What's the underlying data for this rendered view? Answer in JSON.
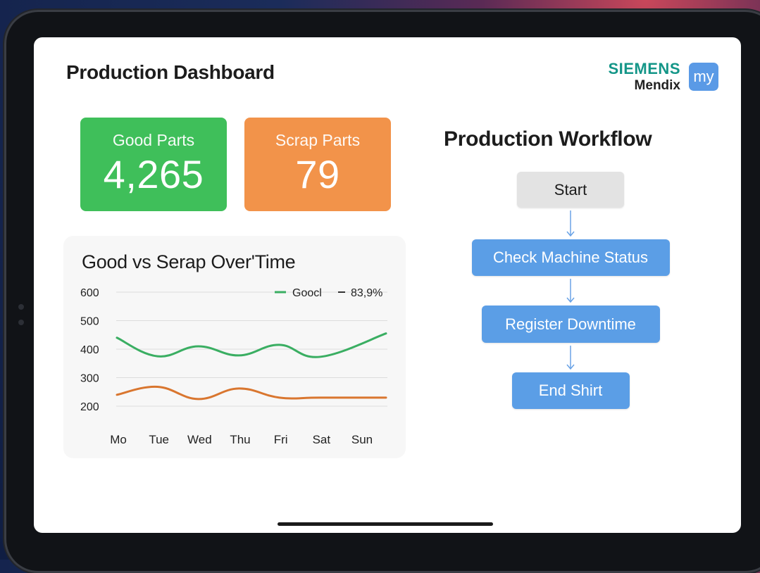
{
  "header": {
    "title": "Production Dashboard",
    "brand": {
      "name": "SIEMENS",
      "product": "Mendix",
      "badge": "my"
    }
  },
  "kpis": {
    "good": {
      "label": "Good Parts",
      "value": "4,265",
      "color": "#3fbf5a"
    },
    "scrap": {
      "label": "Scrap Parts",
      "value": "79",
      "color": "#f2934a"
    }
  },
  "chart": {
    "title": "Good vs Serap Over'Time",
    "legend": {
      "good_label": "Goocl",
      "scrap_label": "83,9%"
    }
  },
  "chart_data": {
    "type": "line",
    "title": "Good vs Serap Over'Time",
    "categories": [
      "Mo",
      "Tue",
      "Wed",
      "Thu",
      "Fri",
      "Sat",
      "Sun"
    ],
    "yticks": [
      600,
      500,
      400,
      300,
      200
    ],
    "ylim": [
      200,
      600
    ],
    "grid": true,
    "legend_position": "top-right",
    "series": [
      {
        "name": "Goocl",
        "color": "#3aae62",
        "values": [
          440,
          375,
          410,
          378,
          415,
          373,
          455
        ]
      },
      {
        "name": "83,9%",
        "color": "#d9762f",
        "values": [
          240,
          268,
          225,
          262,
          230,
          230,
          230
        ]
      }
    ]
  },
  "workflow": {
    "title": "Production Workflow",
    "steps": [
      {
        "label": "Start",
        "kind": "start"
      },
      {
        "label": "Check Machine Status",
        "kind": "step"
      },
      {
        "label": "Register Downtime",
        "kind": "step"
      },
      {
        "label": "End Shirt",
        "kind": "step"
      }
    ],
    "step_color": "#5b9ee6"
  }
}
